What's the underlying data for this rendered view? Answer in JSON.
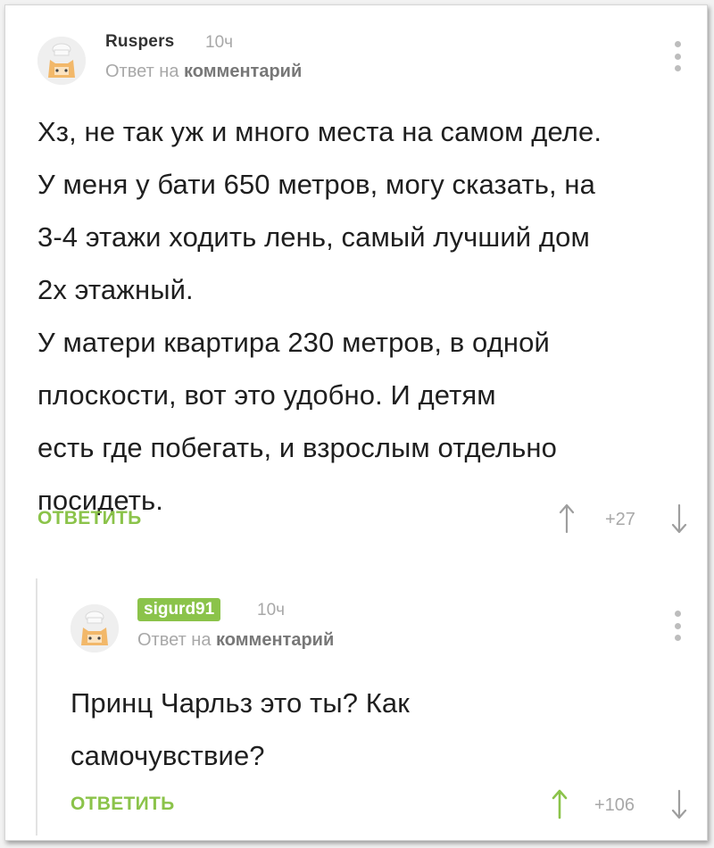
{
  "comments": [
    {
      "author": "Ruspers",
      "time": "10ч",
      "reply_prefix": "Ответ на",
      "reply_target": "комментарий",
      "text": [
        "Хз, не так уж и много места на самом деле.",
        "У меня у бати 650 метров, могу сказать, на",
        "3-4 этажи ходить лень, самый лучший дом",
        "2х этажный.",
        "У матери квартира 230 метров, в одной",
        "плоскости, вот это удобно. И детям",
        "есть где побегать, и взрослым отдельно",
        "посидеть."
      ],
      "reply_label": "ОТВЕТИТЬ",
      "score": "+27",
      "avatar_icon": "chef-cat-avatar-icon"
    },
    {
      "author": "sigurd91",
      "time": "10ч",
      "reply_prefix": "Ответ на",
      "reply_target": "комментарий",
      "text": [
        "Принц Чарльз это ты? Как",
        "самочувствие?"
      ],
      "reply_label": "ОТВЕТИТЬ",
      "score": "+106",
      "avatar_icon": "chef-cat-avatar-icon",
      "highlighted": true
    }
  ],
  "colors": {
    "accent": "#8bc34a",
    "muted": "#a8a8a8",
    "text": "#1f1f1f"
  }
}
